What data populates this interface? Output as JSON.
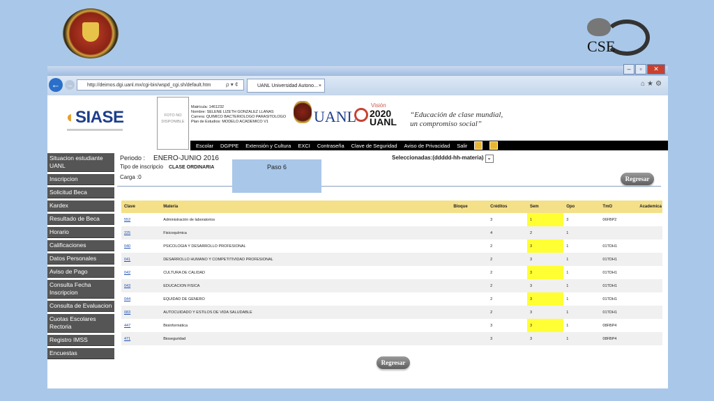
{
  "logos": {
    "right_text": "CSE"
  },
  "browser": {
    "url": "http://deimos.dgi.uanl.mx/cgi-bin/wspd_cgi.sh/default.htm",
    "addr_icons": "ρ ▾ ¢",
    "tab_title": "UANL Universidad Autono...",
    "tab_close": "×"
  },
  "header": {
    "siase_label": "SIASE",
    "foto_text": "FOTO NO DISPONIBLE",
    "info": {
      "matricula": "Matrícula: 1461232",
      "nombre": "Nombre: SELENE LIZETH GONZALEZ LLANAS",
      "carrera": "Carrera: QUIMICO BACTERIOLOGO PARASITOLOGO",
      "plan": "Plan de Estudios: MODELO ACADEMICO V1"
    },
    "uanl_text": "UANL",
    "vision_label": "Visión",
    "vision_num": "2020 UANL",
    "slogan_1": "“Educación de clase mundial,",
    "slogan_2": "un compromiso social”"
  },
  "menu": [
    "Escolar",
    "DGPPE",
    "Extensión y Cultura",
    "EXCI",
    "Contraseña",
    "Clave de Seguridad",
    "Aviso de Privacidad",
    "Salir"
  ],
  "sidebar": [
    "Situacion estudiante UANL",
    "Inscripcion",
    "Solicitud Beca",
    "Kardex",
    "Resultado de Beca",
    "Horario",
    "Calificaciones",
    "Datos Personales",
    "Aviso de Pago",
    "Consulta Fecha Inscripcion",
    "Consulta de Evaluacion",
    "Cuotas Escolares Rectoria",
    "Registro IMSS",
    "Encuestas"
  ],
  "content": {
    "periodo_label": "Periodo :",
    "periodo_value": "ENERO-JUNIO 2016",
    "tipo_label": "Tipo de inscripcio",
    "tipo_value": "CLASE ORDINARIA",
    "carga": "Carga :0",
    "seleccionadas": "Seleccionadas:(ddddd-hh-materia)",
    "regresar": "Regresar",
    "paso": "Paso 6"
  },
  "table": {
    "headers": [
      "Clave",
      "Materia",
      "Bloque",
      "Créditos",
      "Sem",
      "Opo",
      "TmO",
      "Academica"
    ],
    "rows": [
      [
        "552",
        "Administración de laboratorios",
        "",
        "3",
        "1",
        "3",
        "06FBP2",
        ""
      ],
      [
        "225",
        "Fisicoquímica",
        "",
        "4",
        "2",
        "1",
        "",
        ""
      ],
      [
        "040",
        "PSICOLOGIA Y DESARROLLO PROFESIONAL",
        "",
        "2",
        "3",
        "1",
        "01TDH1",
        ""
      ],
      [
        "041",
        "DESARROLLO HUMANO Y COMPETITIVIDAD PROFESIONAL",
        "",
        "2",
        "3",
        "1",
        "01TDH1",
        ""
      ],
      [
        "042",
        "CULTURA DE CALIDAD",
        "",
        "2",
        "3",
        "1",
        "01TDH1",
        ""
      ],
      [
        "043",
        "EDUCACION FISICA",
        "",
        "2",
        "3",
        "1",
        "01TDH1",
        ""
      ],
      [
        "044",
        "EQUIDAD DE GENERO",
        "",
        "2",
        "3",
        "1",
        "01TDH1",
        ""
      ],
      [
        "083",
        "AUTOCUIDADO Y ESTILOS DE VIDA SALUDABLE",
        "",
        "2",
        "3",
        "1",
        "01TDH1",
        ""
      ],
      [
        "447",
        "Bioinformática",
        "",
        "3",
        "3",
        "1",
        "08FBP4",
        ""
      ],
      [
        "471",
        "Bioseguridad",
        "",
        "3",
        "3",
        "1",
        "08FBP4",
        ""
      ]
    ]
  },
  "colors": {
    "accent": "#1d3e8a",
    "sem_highlight": "#ffff33",
    "header_row": "#f5e08a"
  }
}
